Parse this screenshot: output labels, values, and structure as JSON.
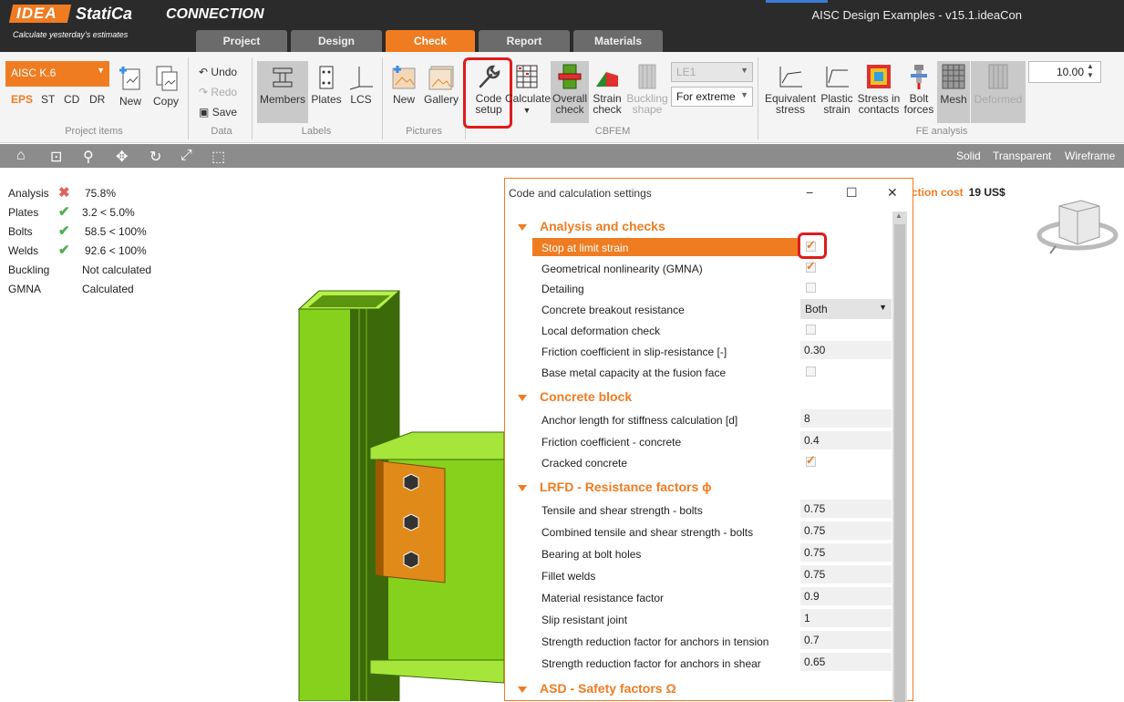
{
  "app": {
    "logo_idea": "IDEA",
    "logo_statica": "StatiCa",
    "product": "CONNECTION",
    "tagline": "Calculate yesterday's estimates",
    "file_title": "AISC Design Examples - v15.1.ideaCon"
  },
  "tabs": [
    {
      "label": "Project"
    },
    {
      "label": "Design"
    },
    {
      "label": "Check"
    },
    {
      "label": "Report"
    },
    {
      "label": "Materials"
    }
  ],
  "ribbon": {
    "project_items": {
      "selected": "AISC K.6",
      "operations": [
        "EPS",
        "ST",
        "CD",
        "DR"
      ],
      "new_label": "New",
      "copy_label": "Copy",
      "group_label": "Project items"
    },
    "data": {
      "undo": "Undo",
      "redo": "Redo",
      "save": "Save",
      "group_label": "Data"
    },
    "labels": {
      "members": "Members",
      "plates": "Plates",
      "lcs": "LCS",
      "group_label": "Labels"
    },
    "pictures": {
      "new": "New",
      "gallery": "Gallery",
      "group_label": "Pictures"
    },
    "cbfem": {
      "code_setup_1": "Code",
      "code_setup_2": "setup",
      "calculate": "Calculate",
      "overall_1": "Overall",
      "overall_2": "check",
      "strain_1": "Strain",
      "strain_2": "check",
      "buckling_1": "Buckling",
      "buckling_2": "shape",
      "load_effect": "LE1",
      "extreme": "For extreme",
      "group_label": "CBFEM"
    },
    "fe_analysis": {
      "eq_1": "Equivalent",
      "eq_2": "stress",
      "pl_1": "Plastic",
      "pl_2": "strain",
      "st_1": "Stress in",
      "st_2": "contacts",
      "bf_1": "Bolt",
      "bf_2": "forces",
      "mesh": "Mesh",
      "deformed": "Deformed",
      "scale": "10.00",
      "group_label": "FE analysis"
    }
  },
  "toolbar": {
    "solid": "Solid",
    "transparent": "Transparent",
    "wireframe": "Wireframe"
  },
  "results": [
    {
      "label": "Analysis",
      "status": "fail",
      "value": "75.8%"
    },
    {
      "label": "Plates",
      "status": "ok",
      "value": "3.2 < 5.0%"
    },
    {
      "label": "Bolts",
      "status": "ok",
      "value": "58.5 < 100%"
    },
    {
      "label": "Welds",
      "status": "ok",
      "value": "92.6 < 100%"
    },
    {
      "label": "Buckling",
      "status": "",
      "value": "Not calculated"
    },
    {
      "label": "GMNA",
      "status": "",
      "value": "Calculated"
    }
  ],
  "cost": {
    "label": "ction cost",
    "value": "19 US$"
  },
  "dialog": {
    "title": "Code and calculation settings",
    "sections": [
      {
        "title": "Analysis and checks"
      },
      {
        "title": "Concrete block"
      },
      {
        "title": "LRFD - Resistance factors ϕ"
      },
      {
        "title": "ASD - Safety factors Ω"
      }
    ],
    "rows": {
      "stop_limit": {
        "label": "Stop at limit strain",
        "checked": true
      },
      "gmna": {
        "label": "Geometrical nonlinearity (GMNA)",
        "checked": true
      },
      "detailing": {
        "label": "Detailing",
        "checked": false
      },
      "breakout": {
        "label": "Concrete breakout resistance",
        "value": "Both"
      },
      "local_def": {
        "label": "Local deformation check",
        "checked": false
      },
      "friction_slip": {
        "label": "Friction coefficient in slip-resistance [-]",
        "value": "0.30"
      },
      "base_metal": {
        "label": "Base metal capacity at the fusion face",
        "checked": false
      },
      "anchor_len": {
        "label": "Anchor length for stiffness calculation [d]",
        "value": "8"
      },
      "friction_concrete": {
        "label": "Friction coefficient - concrete",
        "value": "0.4"
      },
      "cracked": {
        "label": "Cracked concrete",
        "checked": true
      },
      "tensile_shear": {
        "label": "Tensile and shear strength - bolts",
        "value": "0.75"
      },
      "combined": {
        "label": "Combined tensile and shear strength - bolts",
        "value": "0.75"
      },
      "bearing": {
        "label": "Bearing at bolt holes",
        "value": "0.75"
      },
      "fillet": {
        "label": "Fillet welds",
        "value": "0.75"
      },
      "material": {
        "label": "Material resistance factor",
        "value": "0.9"
      },
      "slip": {
        "label": "Slip resistant joint",
        "value": "1"
      },
      "anchors_tension": {
        "label": "Strength reduction factor for anchors in tension",
        "value": "0.7"
      },
      "anchors_shear": {
        "label": "Strength reduction factor for anchors in shear",
        "value": "0.65"
      }
    }
  },
  "colors": {
    "accent": "#f07c22",
    "highlight": "#e01b1b",
    "steel": "#8cd61e",
    "plate": "#e08a1a"
  }
}
